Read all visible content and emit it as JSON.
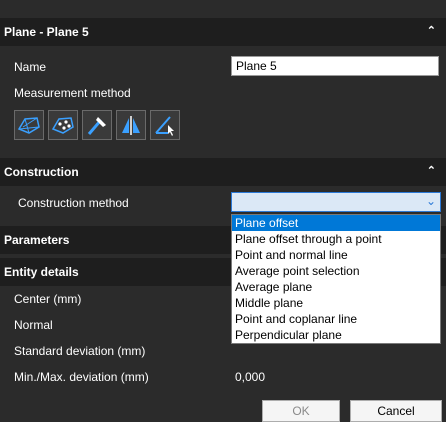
{
  "panel": {
    "title": "Plane - Plane 5"
  },
  "name_row": {
    "label": "Name",
    "value": "Plane 5"
  },
  "measurement": {
    "label": "Measurement method",
    "icons": [
      "surface-mesh-icon",
      "surface-points-icon",
      "probe-icon",
      "symmetry-plane-icon",
      "pointer-plane-icon"
    ]
  },
  "construction": {
    "title": "Construction",
    "method_label": "Construction method",
    "selected": "",
    "options": [
      "Plane offset",
      "Plane offset through a point",
      "Point and normal line",
      "Average point selection",
      "Average plane",
      "Middle plane",
      "Point and coplanar line",
      "Perpendicular plane"
    ]
  },
  "parameters": {
    "title": "Parameters"
  },
  "entity_details": {
    "title": "Entity details",
    "rows": [
      {
        "label": "Center (mm)",
        "value": ""
      },
      {
        "label": "Normal",
        "value": ""
      },
      {
        "label": "Standard deviation (mm)",
        "value": ""
      },
      {
        "label": "Min./Max. deviation (mm)",
        "value": "0,000"
      }
    ]
  },
  "footer": {
    "ok_label": "OK",
    "cancel_label": "Cancel"
  },
  "colors": {
    "accent": "#0078d7",
    "header_bg": "#1e1e1e",
    "panel_bg": "#2b2b2b",
    "icon_blue": "#3aa0ff"
  }
}
